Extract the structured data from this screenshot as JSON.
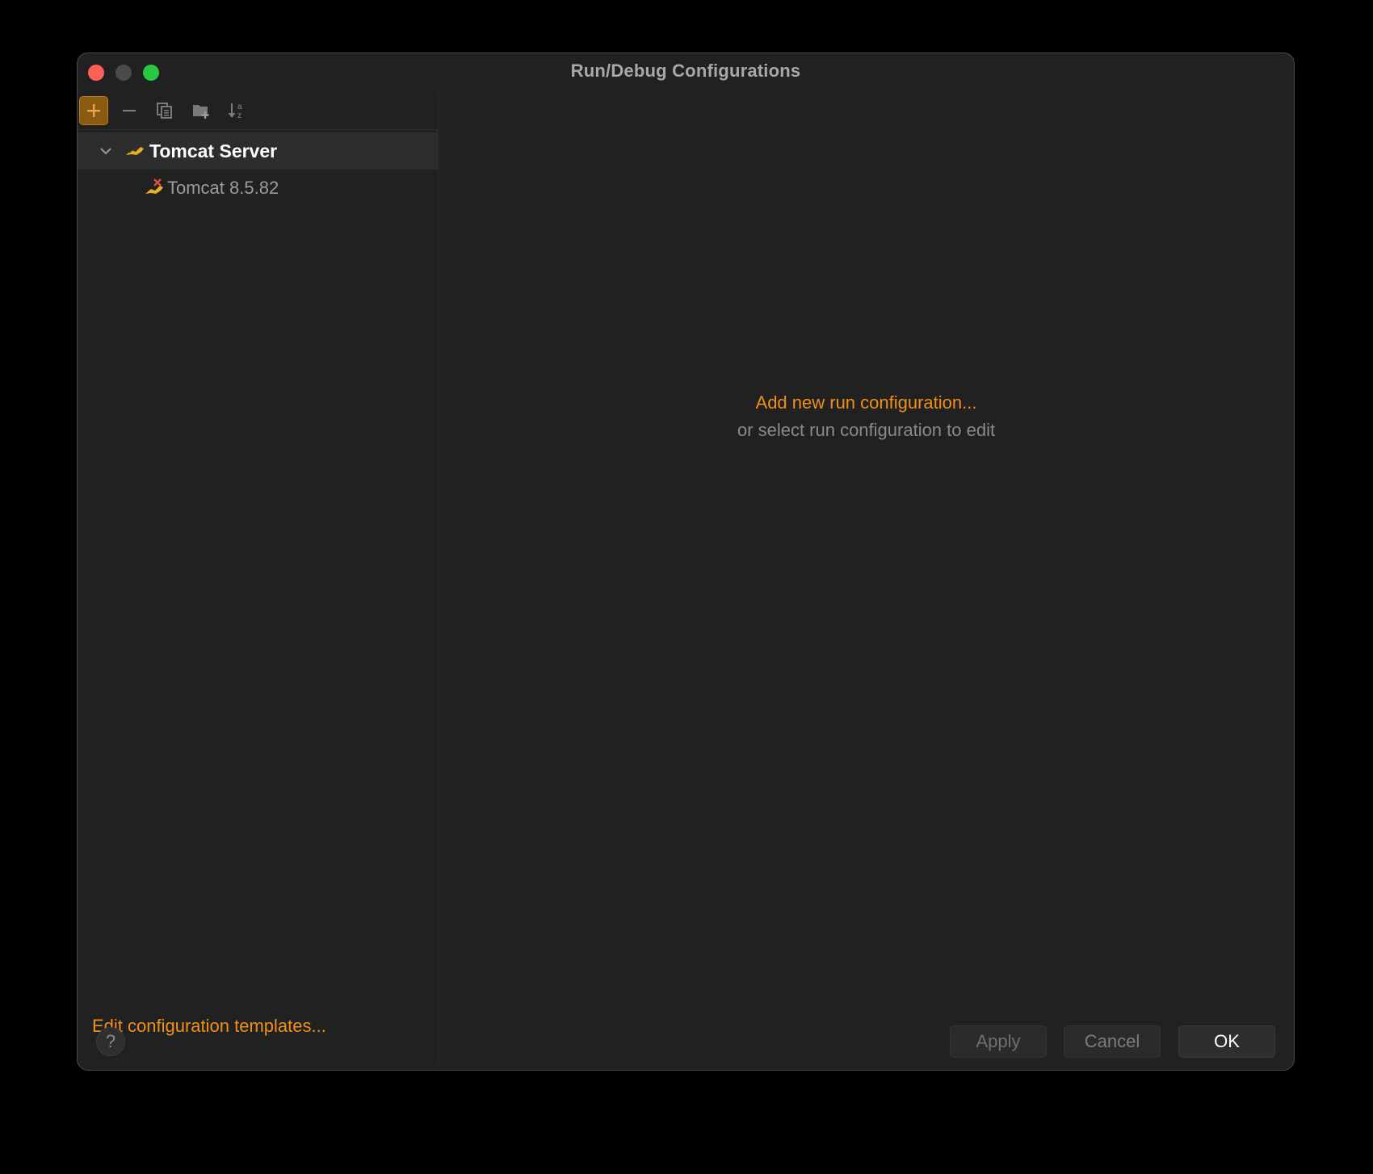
{
  "window": {
    "title": "Run/Debug Configurations"
  },
  "toolbar": {
    "icons": [
      "add-icon",
      "remove-icon",
      "copy-icon",
      "new-folder-icon",
      "sort-alpha-icon"
    ]
  },
  "tree": {
    "group": {
      "label": "Tomcat Server",
      "expanded": true
    },
    "items": [
      {
        "label": "Tomcat 8.5.82"
      }
    ]
  },
  "left_footer": {
    "edit_templates_label": "Edit configuration templates..."
  },
  "empty_state": {
    "link_label": "Add new run configuration...",
    "hint": "or select run configuration to edit"
  },
  "footer": {
    "help_label": "?",
    "apply_label": "Apply",
    "cancel_label": "Cancel",
    "ok_label": "OK"
  },
  "colors": {
    "accent": "#f0901b",
    "background": "#212121",
    "close": "#fe5f57",
    "maximize": "#28c840"
  }
}
